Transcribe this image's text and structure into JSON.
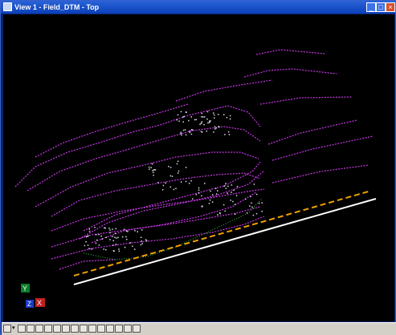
{
  "window": {
    "title": "View 1 - Field_DTM - Top"
  },
  "titlebar_buttons": {
    "minimize_icon": "minimize-icon",
    "maximize_icon": "maximize-icon",
    "close_icon": "close-icon"
  },
  "axis_triad": {
    "y_label": "Y",
    "z_label": "Z",
    "x_label": "X"
  },
  "colors": {
    "background": "#000000",
    "contour": "#c837e6",
    "points": "#d9d9e8",
    "breakline_green": "#3cc83c",
    "dashed_line": "#f0a000",
    "white_line": "#ffffff"
  },
  "view_tools": [
    "view-control-icon",
    "dropdown-icon",
    "update-icon",
    "zoom-in-icon",
    "zoom-out-icon",
    "window-area-icon",
    "fit-view-icon",
    "rotate-icon",
    "pan-icon",
    "view-previous-icon",
    "view-next-icon",
    "copy-view-icon",
    "view-attributes-icon",
    "display-style-icon",
    "camera-icon",
    "render-icon"
  ]
}
